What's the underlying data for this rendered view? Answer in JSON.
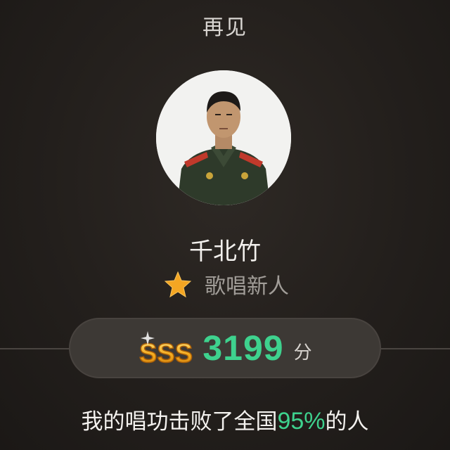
{
  "song": {
    "title": "再见"
  },
  "user": {
    "name": "千北竹"
  },
  "rank": {
    "icon": "star-icon",
    "label": "歌唱新人",
    "star_color": "#f4a623"
  },
  "score": {
    "grade": "SSS",
    "value": "3199",
    "unit": "分",
    "accent": "#3ed28e"
  },
  "result": {
    "prefix": "我的唱功击败了全国",
    "percent": "95%",
    "suffix": "的人"
  }
}
